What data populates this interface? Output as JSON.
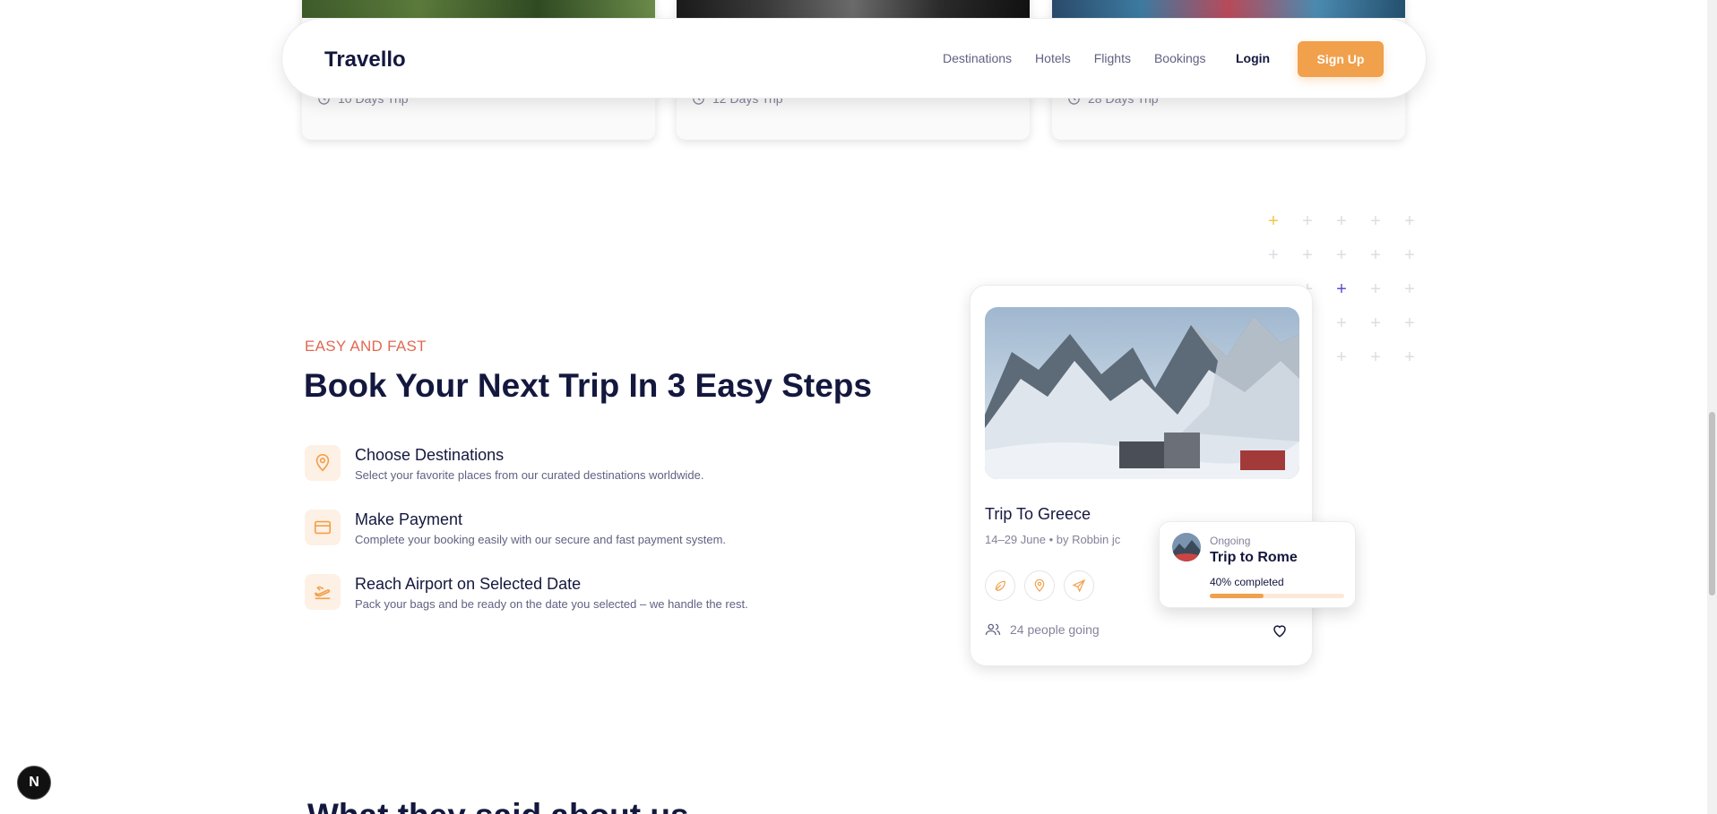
{
  "top_cards": [
    {
      "duration": "10 Days Trip",
      "icon": "clock-icon"
    },
    {
      "duration": "12 Days Trip",
      "icon": "clock-icon"
    },
    {
      "duration": "28 Days Trip",
      "icon": "clock-icon"
    }
  ],
  "nav": {
    "logo": "Travello",
    "links": [
      "Destinations",
      "Hotels",
      "Flights",
      "Bookings"
    ],
    "login": "Login",
    "signup": "Sign Up"
  },
  "section": {
    "eyebrow": "EASY AND FAST",
    "headline": "Book Your Next Trip In 3 Easy Steps",
    "steps": [
      {
        "title": "Choose Destinations",
        "desc": "Select your favorite places from our curated destinations worldwide.",
        "icon": "map-pin-icon"
      },
      {
        "title": "Make Payment",
        "desc": "Complete your booking easily with our secure and fast payment system.",
        "icon": "credit-card-icon"
      },
      {
        "title": "Reach Airport on Selected Date",
        "desc": "Pack your bags and be ready on the date you selected – we handle the rest.",
        "icon": "plane-takeoff-icon"
      }
    ]
  },
  "trip_card": {
    "title": "Trip To Greece",
    "meta": "14–29 June • by Robbin jc",
    "people": "24 people going",
    "icons": [
      "leaf-icon",
      "map-pin-icon",
      "send-icon"
    ]
  },
  "ongoing": {
    "label": "Ongoing",
    "name": "Trip to Rome",
    "progress_text": "40% completed",
    "progress": 0.4
  },
  "next_section": {
    "heading": "What they said about us"
  },
  "badge": "N",
  "colors": {
    "accent_orange": "#f1a04b",
    "eyebrow_red": "#df6951",
    "plus_yellow": "#f1c84b",
    "plus_purple": "#5a4fcf",
    "heading": "#14183e"
  }
}
